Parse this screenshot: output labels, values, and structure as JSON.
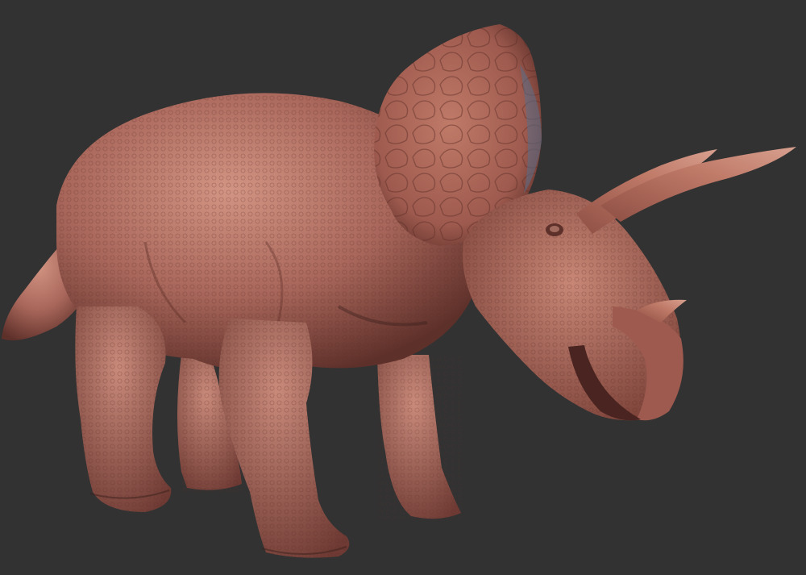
{
  "scene": {
    "background_color": "#323232",
    "subject": "triceratops-sculpt",
    "colors": {
      "skin_light": "#c98a7a",
      "skin_mid": "#a8665a",
      "skin_dark": "#6e3a33",
      "shadow": "#3a1f1c",
      "frill_blue_tint": "#5a6f8a",
      "horn": "#b5705f",
      "beak": "#9e5a4e"
    }
  }
}
